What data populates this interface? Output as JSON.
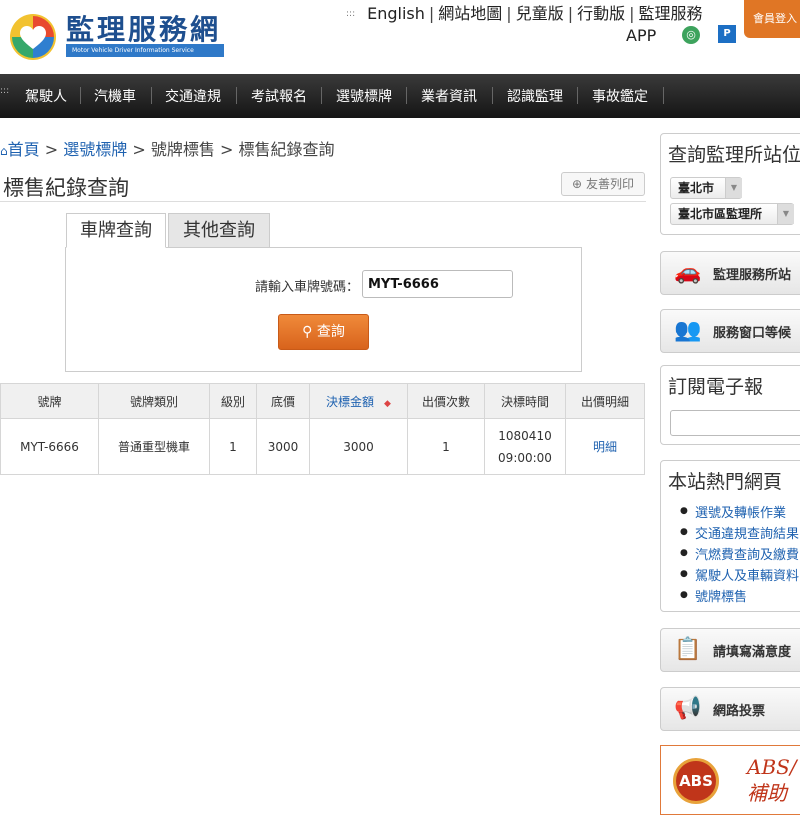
{
  "header": {
    "site_name": "監理服務網",
    "site_subtitle": "Motor Vehicle Driver Information Service",
    "toplinks": [
      "English",
      "網站地圖",
      "兒童版",
      "行動版",
      "監理服務"
    ],
    "app_label": "APP",
    "member_login": "會員登入"
  },
  "nav": {
    "items": [
      "駕駛人",
      "汽機車",
      "交通違規",
      "考試報名",
      "選號標牌",
      "業者資訊",
      "認識監理",
      "事故鑑定"
    ]
  },
  "breadcrumb": {
    "home": "首頁",
    "items": [
      "選號標牌",
      "號牌標售",
      "標售紀錄查詢"
    ],
    "sep": ">"
  },
  "page": {
    "title": "標售紀錄查詢",
    "print_label": "友善列印"
  },
  "tabs": [
    "車牌查詢",
    "其他查詢"
  ],
  "search": {
    "label": "請輸入車牌號碼：",
    "value": "MYT-6666",
    "button_label": "查詢"
  },
  "results": {
    "columns": [
      "號牌",
      "號牌類別",
      "級別",
      "底價",
      "決標金額",
      "出價次數",
      "決標時間",
      "出價明細"
    ],
    "rows": [
      {
        "plate": "MYT-6666",
        "category": "普通重型機車",
        "level": "1",
        "base_price": "3000",
        "winning_bid": "3000",
        "bid_count": "1",
        "award_date": "1080410",
        "award_time": "09:00:00",
        "detail": "明細"
      }
    ]
  },
  "sidebar": {
    "station_title": "查詢監理所站位",
    "city_select": "臺北市",
    "office_select": "臺北市區監理所",
    "service_station_btn": "監理服務所站",
    "queue_btn": "服務窗口等候",
    "newsletter_title": "訂閱電子報",
    "hot_title": "本站熱門網頁",
    "hot_links": [
      "選號及轉帳作業",
      "交通違規查詢結果",
      "汽燃費查詢及繳費",
      "駕駛人及車輛資料",
      "號牌標售"
    ],
    "survey_btn": "請填寫滿意度",
    "vote_btn": "網路投票",
    "abs_badge": "ABS",
    "abs_line1": "ABS/",
    "abs_line2": "補助"
  },
  "colors": {
    "link_blue": "#1f62b0",
    "nav_bg": "#1e1e1e",
    "orange_button": "#e07625",
    "logo_blue": "#1e4f8f"
  }
}
